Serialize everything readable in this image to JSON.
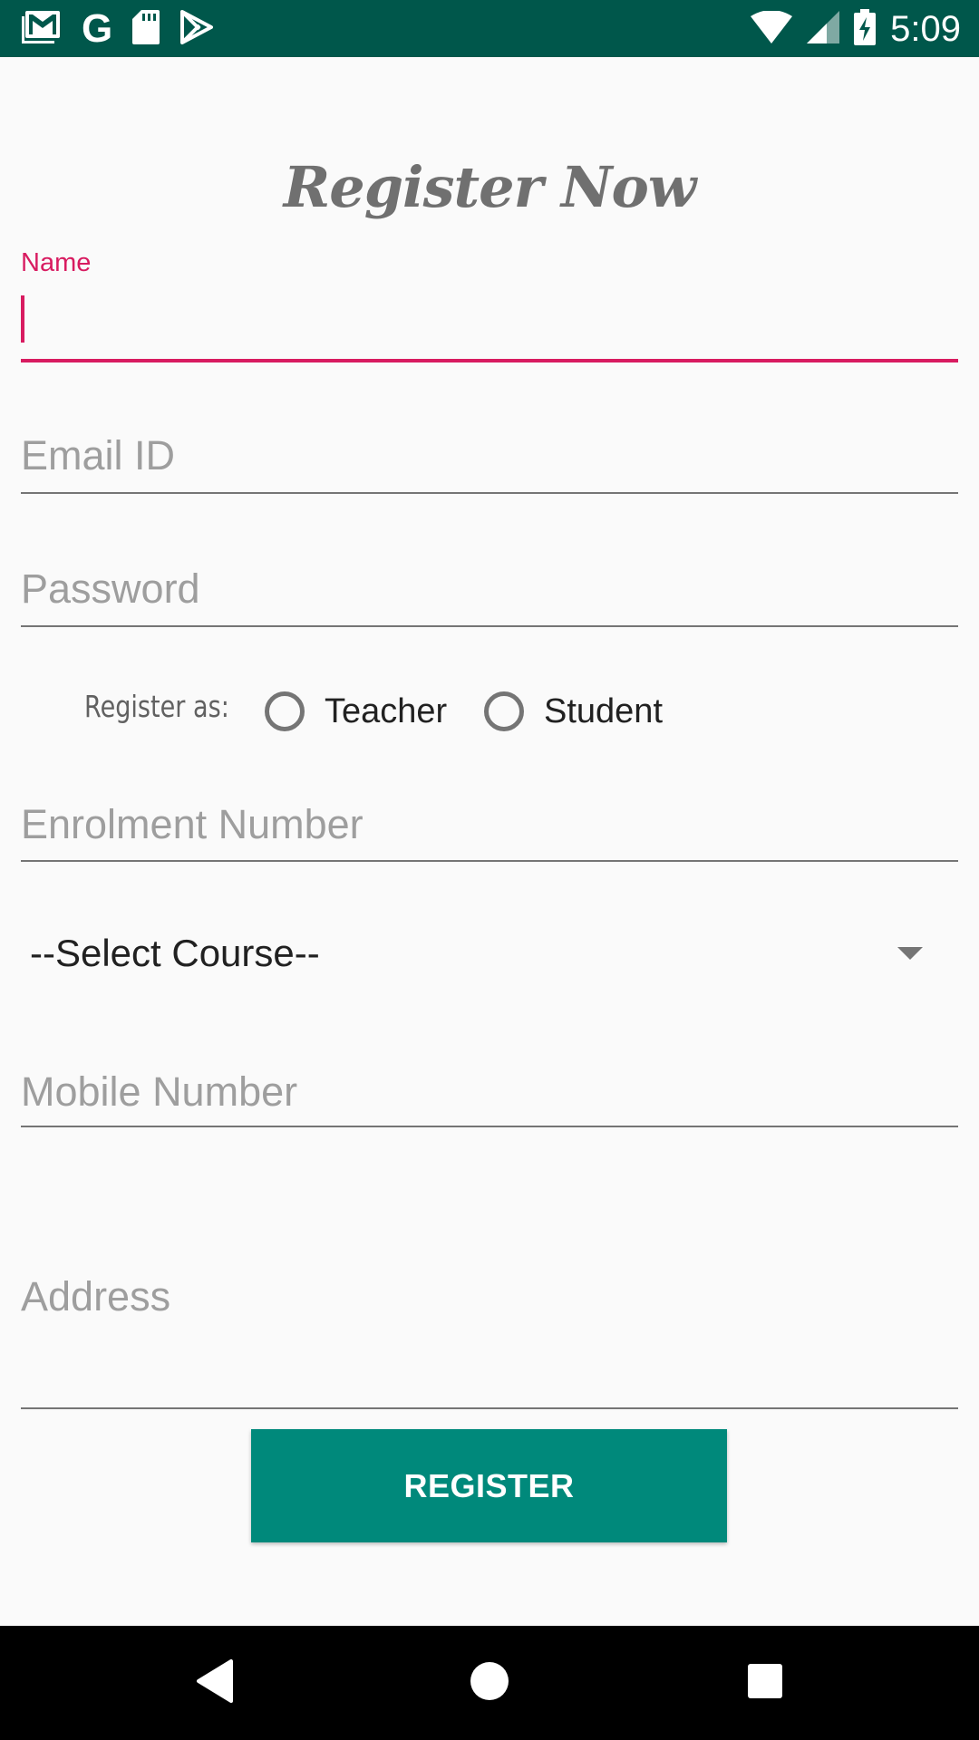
{
  "status_bar": {
    "time": "5:09",
    "left_icons": [
      "gmail-icon",
      "google-icon",
      "sd-card-icon",
      "play-store-icon"
    ],
    "right_icons": [
      "wifi-icon",
      "cell-signal-icon",
      "battery-charging-icon"
    ],
    "google_glyph": "G",
    "background_color": "#00574b"
  },
  "page": {
    "title": "Register Now"
  },
  "form": {
    "name": {
      "label": "Name",
      "value": ""
    },
    "email": {
      "placeholder": "Email ID",
      "value": ""
    },
    "password": {
      "placeholder": "Password",
      "value": ""
    },
    "register_as": {
      "label": "Register as:",
      "options": [
        {
          "label": "Teacher",
          "selected": false
        },
        {
          "label": "Student",
          "selected": false
        }
      ]
    },
    "enrolment": {
      "placeholder": "Enrolment Number",
      "value": ""
    },
    "course": {
      "selected": "--Select Course--"
    },
    "mobile": {
      "placeholder": "Mobile Number",
      "value": ""
    },
    "address": {
      "placeholder": "Address",
      "value": ""
    },
    "submit_label": "REGISTER"
  },
  "colors": {
    "accent": "#d81b60",
    "button": "#00897b",
    "background": "#fafafa"
  },
  "nav_bar": {
    "icons": [
      "back-icon",
      "home-icon",
      "recents-icon"
    ]
  }
}
